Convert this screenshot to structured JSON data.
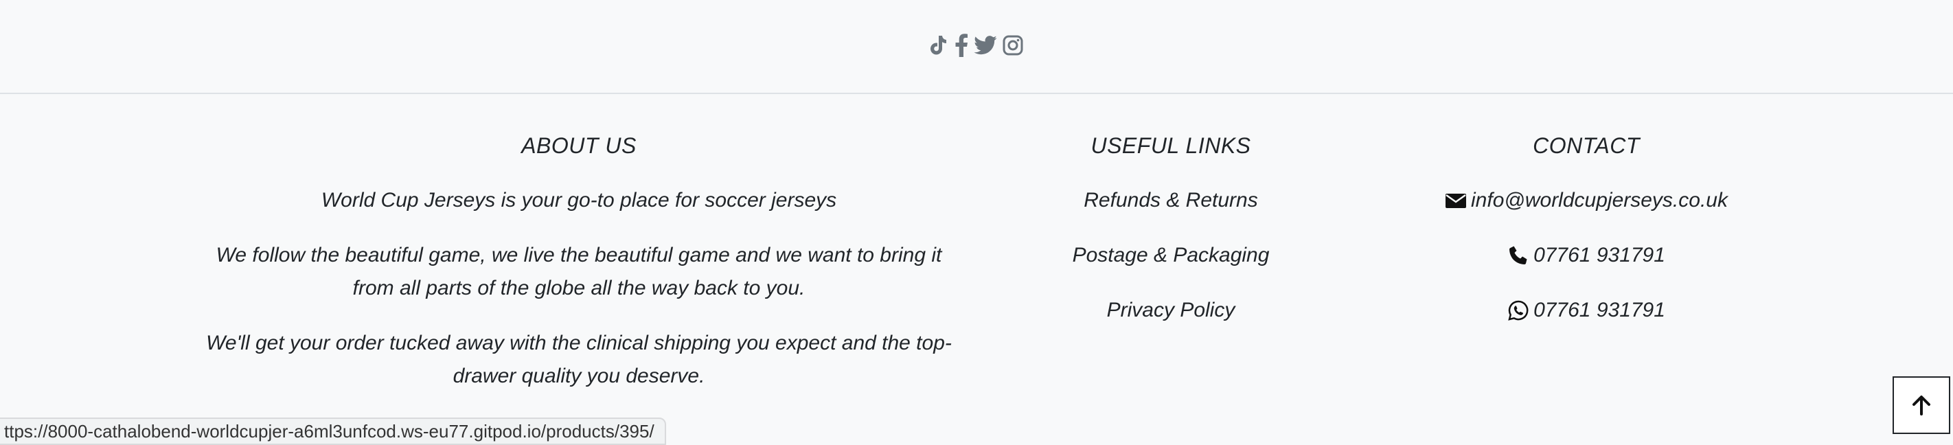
{
  "social": {
    "icons": [
      "tiktok-icon",
      "facebook-icon",
      "twitter-icon",
      "instagram-icon"
    ]
  },
  "about": {
    "heading": "ABOUT US",
    "paragraph1": "World Cup Jerseys is your go-to place for soccer jerseys",
    "paragraph2": "We follow the beautiful game, we live the beautiful game and we want to bring it from all parts of the globe all the way back to you.",
    "paragraph3": "We'll get your order tucked away with the clinical shipping you expect and the top-drawer quality you deserve."
  },
  "useful_links": {
    "heading": "USEFUL LINKS",
    "items": [
      "Refunds & Returns",
      "Postage & Packaging",
      "Privacy Policy"
    ]
  },
  "contact": {
    "heading": "CONTACT",
    "email": "info@worldcupjerseys.co.uk",
    "phone": "07761 931791",
    "whatsapp": "07761 931791"
  },
  "status_bar": {
    "url": "ttps://8000-cathalobend-worldcupjer-a6ml3unfcod.ws-eu77.gitpod.io/products/395/"
  },
  "colors": {
    "background": "#f8f9fa",
    "text": "#212529",
    "icon": "#6c757d"
  }
}
